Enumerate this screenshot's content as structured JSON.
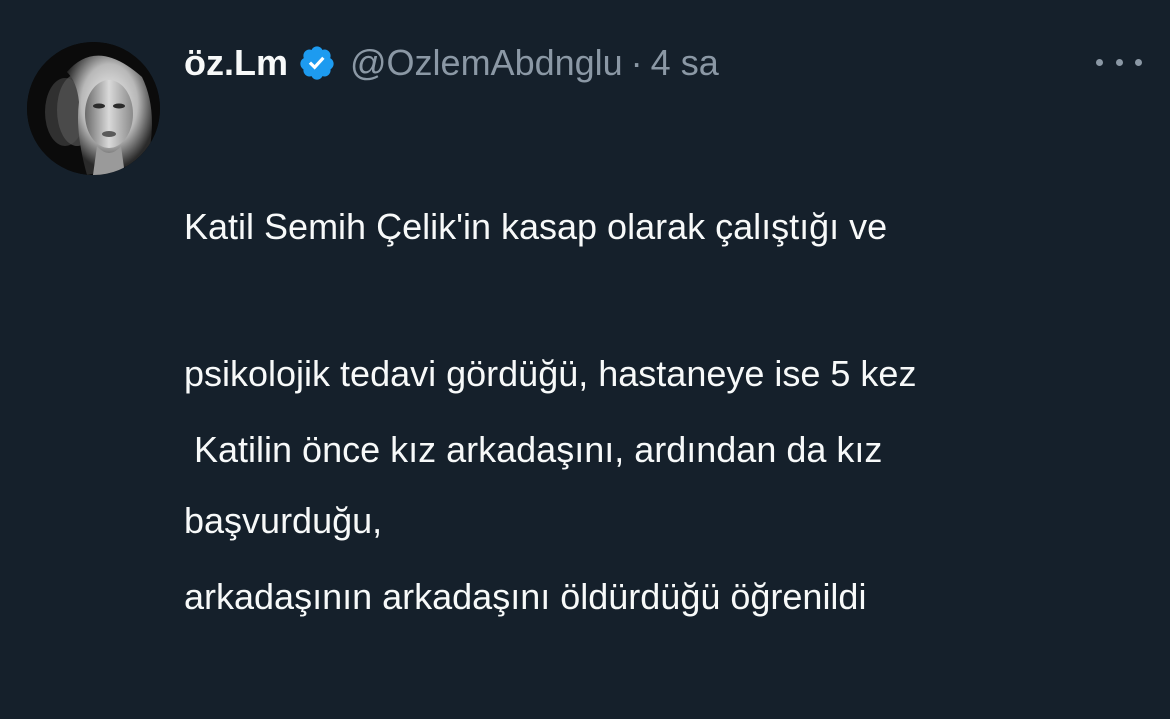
{
  "tweet": {
    "display_name": "öz.Lm",
    "verified_icon": "verified-badge-icon",
    "handle": "@OzlemAbdnglu",
    "separator": "·",
    "time": "4 sa",
    "more_icon": "more-options-icon",
    "paragraphs": [
      {
        "lines": [
          "Katil Semih Çelik'in kasap olarak çalıştığı ve",
          "psikolojik tedavi gördüğü, hastaneye ise 5 kez",
          "başvurduğu,"
        ]
      },
      {
        "lines": [
          " Katilin önce kız arkadaşını, ardından da kız",
          "arkadaşının arkadaşını öldürdüğü öğrenildi"
        ]
      }
    ]
  },
  "colors": {
    "background": "#15202b",
    "primary_text": "#f7f9f9",
    "secondary_text": "#8b98a5",
    "verified_blue": "#1d9bf0"
  }
}
